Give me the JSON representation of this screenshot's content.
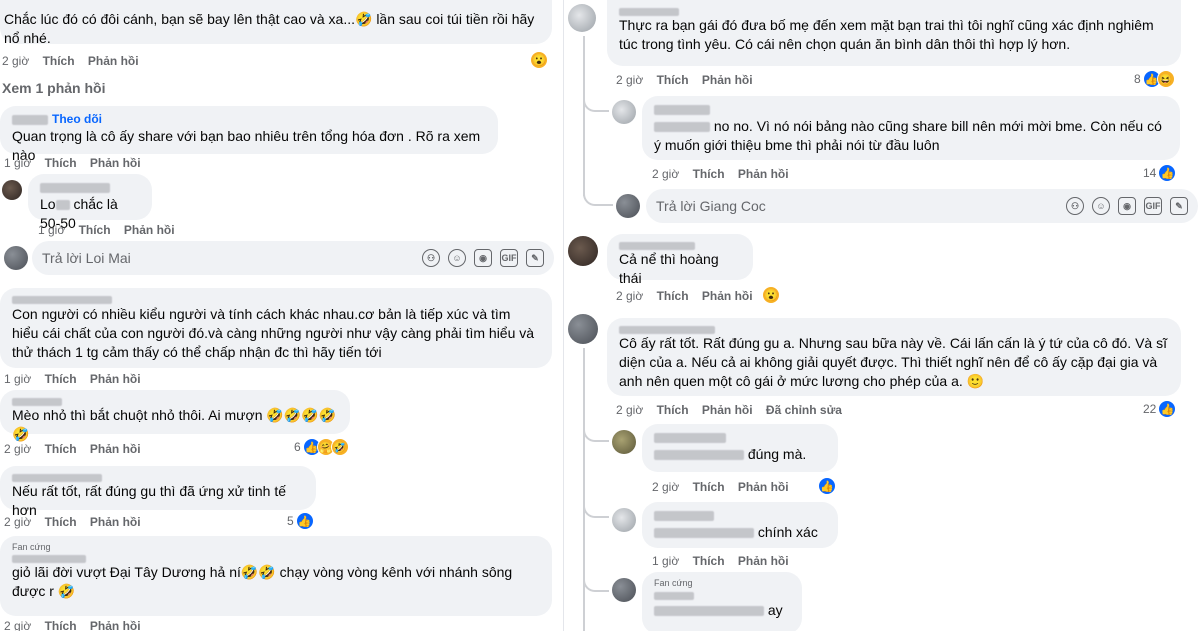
{
  "left": {
    "c1": {
      "text": "Chắc lúc đó có đôi cánh, bạn sẽ bay lên thật cao và xa...🤣 lần sau coi túi tiền rồi hãy nổ nhé.",
      "time": "2 giờ",
      "like": "Thích",
      "reply": "Phản hồi",
      "reaction": "😮"
    },
    "view_replies": "Xem 1 phản hồi",
    "c2": {
      "follow": "Theo dõi",
      "text": "Quan trọng là cô ấy share với bạn bao nhiêu trên tổng hóa đơn . Rõ ra xem nào",
      "time": "1 giờ",
      "like": "Thích",
      "reply": "Phản hồi"
    },
    "c2r": {
      "text_prefix": "Lo",
      "text": "chắc là 50-50",
      "time": "1 giờ",
      "like": "Thích",
      "reply": "Phản hồi"
    },
    "reply_box": {
      "placeholder": "Trả lời Loi Mai"
    },
    "c3": {
      "text": "Con người có nhiều kiểu người và tính cách khác nhau.cơ bản là tiếp xúc và tìm hiểu cái chất của con người đó.và càng những người như vậy càng phải tìm hiểu và thử thách 1 tg cảm thấy có thể chấp nhận đc thì hãy tiến tới",
      "time": "1 giờ",
      "like": "Thích",
      "reply": "Phản hồi"
    },
    "c4": {
      "text": "Mèo nhỏ thì bắt chuột nhỏ thôi. Ai mượn 🤣🤣🤣🤣🤣",
      "time": "2 giờ",
      "like": "Thích",
      "reply": "Phản hồi",
      "count": "6"
    },
    "c5": {
      "text": "Nếu rất tốt, rất đúng gu thì đã ứng xử tinh tế hơn",
      "time": "2 giờ",
      "like": "Thích",
      "reply": "Phản hồi",
      "count": "5"
    },
    "c6": {
      "badge": "Fan cứng",
      "text": "giỏ lãi đời vượt Đại Tây Dương hả ní🤣🤣 chạy vòng vòng kênh với nhánh sông được r 🤣",
      "time": "2 giờ",
      "like": "Thích",
      "reply": "Phản hồi"
    }
  },
  "right": {
    "c1": {
      "text": "Thực ra bạn gái đó đưa bố mẹ đến xem mặt bạn trai thì tôi nghĩ cũng xác định nghiêm túc trong tình yêu. Có cái nên chọn quán ăn bình dân thôi thì hợp lý hơn.",
      "time": "2 giờ",
      "like": "Thích",
      "reply": "Phản hồi",
      "count": "8"
    },
    "c1r": {
      "text": "no no. Vì nó nói bảng nào cũng share bill nên mới mời bme. Còn nếu có ý muốn giới thiệu bme thì phải nói từ đầu luôn",
      "time": "2 giờ",
      "like": "Thích",
      "reply": "Phản hồi",
      "count": "14"
    },
    "reply_box": {
      "placeholder": "Trả lời Giang Coc"
    },
    "c2": {
      "text": "Cả nể thì hoàng thái",
      "time": "2 giờ",
      "like": "Thích",
      "reply": "Phản hồi",
      "reaction": "😮"
    },
    "c3": {
      "text": "Cô ấy rất tốt. Rất đúng gu a. Nhưng sau bữa này về. Cái lấn cấn là ý tứ của cô đó. Và sĩ diện của a. Nếu cả ai không giải quyết được. Thì thiết nghĩ nên để cô ấy cặp đại gia và anh nên quen một cô gái ở mức lương cho phép của a. 🙂",
      "time": "2 giờ",
      "like": "Thích",
      "reply": "Phản hồi",
      "edited": "Đã chỉnh sửa",
      "count": "22"
    },
    "c3r1": {
      "text": "đúng mà.",
      "time": "2 giờ",
      "like": "Thích",
      "reply": "Phản hồi"
    },
    "c3r2": {
      "text": "chính xác",
      "time": "1 giờ",
      "like": "Thích",
      "reply": "Phản hồi"
    },
    "c3r3": {
      "badge": "Fan cứng",
      "text": "ay"
    }
  },
  "colors": {
    "bubble": "#f0f2f5",
    "meta": "#65676b",
    "link": "#0866ff",
    "like": "#0866ff"
  }
}
